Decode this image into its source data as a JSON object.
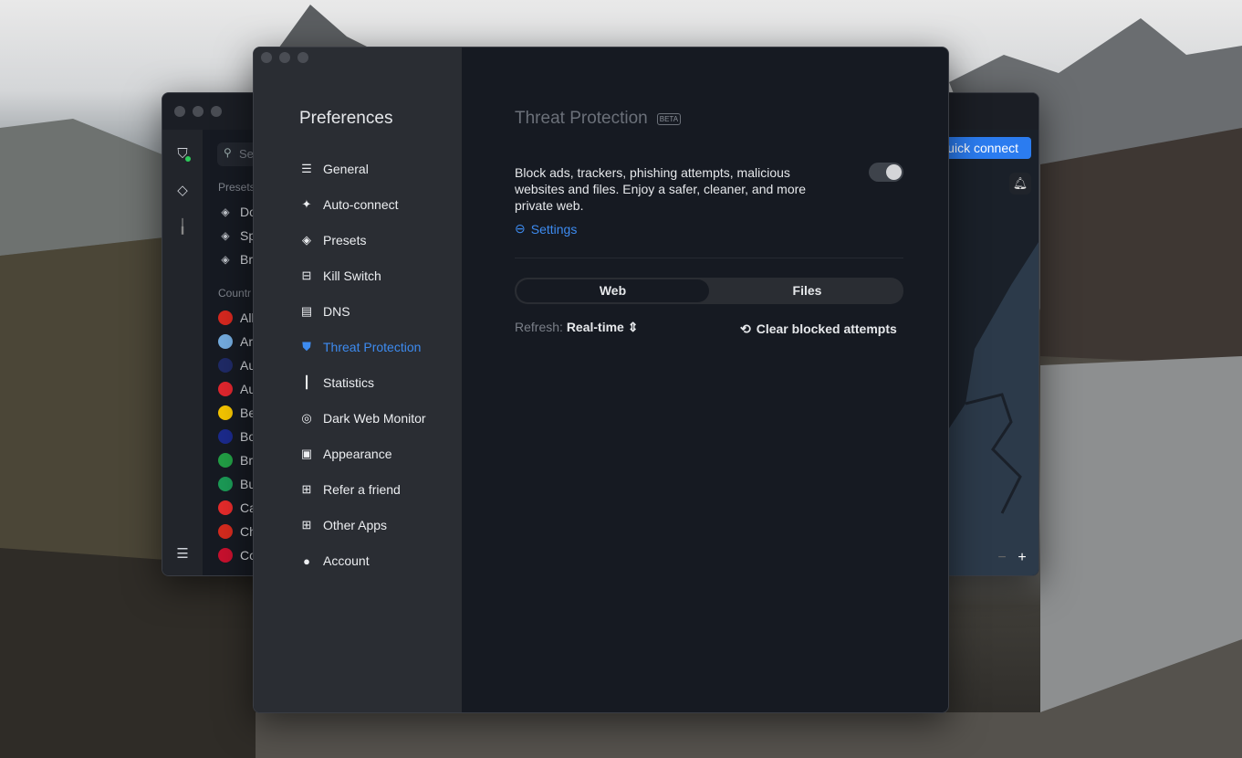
{
  "back_window": {
    "search_placeholder": "Se",
    "presets_label": "Presets",
    "presets": [
      "Do",
      "Sp",
      "Br"
    ],
    "countries_label": "Countr",
    "countries": [
      {
        "name": "Alb",
        "color": "#d6281f"
      },
      {
        "name": "Arg",
        "color": "#74acdf"
      },
      {
        "name": "Au",
        "color": "#1f2a66"
      },
      {
        "name": "Au",
        "color": "#e0262e"
      },
      {
        "name": "Be",
        "color": "#f5c400"
      },
      {
        "name": "Bo",
        "color": "#1b2a8c"
      },
      {
        "name": "Bra",
        "color": "#229e45"
      },
      {
        "name": "Bu",
        "color": "#1b9a56"
      },
      {
        "name": "Ca",
        "color": "#e52b2b"
      },
      {
        "name": "Ch",
        "color": "#d52b1e"
      },
      {
        "name": "Co",
        "color": "#c8102e"
      }
    ],
    "quick_connect": "Quick connect",
    "zoom_out": "−",
    "zoom_in": "+"
  },
  "preferences": {
    "title": "Preferences",
    "nav": [
      {
        "label": "General",
        "icon": "sliders-icon",
        "glyph": "☰"
      },
      {
        "label": "Auto-connect",
        "icon": "wifi-sparkle-icon",
        "glyph": "✦"
      },
      {
        "label": "Presets",
        "icon": "layers-icon",
        "glyph": "◈"
      },
      {
        "label": "Kill Switch",
        "icon": "kill-switch-icon",
        "glyph": "⊟"
      },
      {
        "label": "DNS",
        "icon": "server-icon",
        "glyph": "▤"
      },
      {
        "label": "Threat Protection",
        "icon": "shield-icon",
        "glyph": "⛊",
        "active": true
      },
      {
        "label": "Statistics",
        "icon": "bar-chart-icon",
        "glyph": "┃"
      },
      {
        "label": "Dark Web Monitor",
        "icon": "radar-icon",
        "glyph": "◎"
      },
      {
        "label": "Appearance",
        "icon": "window-icon",
        "glyph": "▣"
      },
      {
        "label": "Refer a friend",
        "icon": "gift-icon",
        "glyph": "⊞"
      },
      {
        "label": "Other Apps",
        "icon": "apps-icon",
        "glyph": "⊞"
      },
      {
        "label": "Account",
        "icon": "user-icon",
        "glyph": "●"
      }
    ]
  },
  "threat_protection": {
    "title": "Threat Protection",
    "badge": "BETA",
    "description": "Block ads, trackers, phishing attempts, malicious websites and files. Enjoy a safer, cleaner, and more private web.",
    "enabled": true,
    "settings_link": "Settings",
    "tabs": [
      "Web",
      "Files"
    ],
    "active_tab": "Web",
    "refresh_label": "Refresh:",
    "refresh_value": "Real-time",
    "clear_button": "Clear blocked attempts"
  },
  "colors": {
    "accent": "#3d8bf0",
    "quick_connect": "#2b7cf0"
  }
}
